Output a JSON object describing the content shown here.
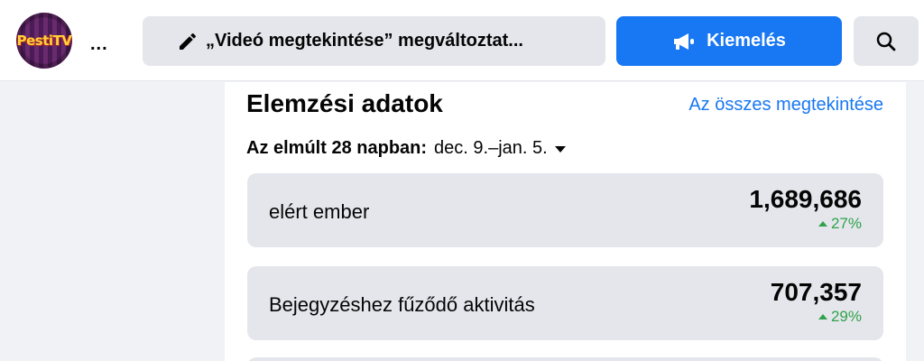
{
  "header": {
    "avatar_logo": "PestiTV",
    "more_label": "...",
    "edit_button_label": "„Videó megtekintése” megváltoztat...",
    "promote_button_label": "Kiemelés",
    "icons": [
      "pencil-icon",
      "megaphone-icon",
      "search-icon"
    ]
  },
  "insights": {
    "title": "Elemzési adatok",
    "see_all": "Az összes megtekintése",
    "period_label": "Az elmúlt 28 napban:",
    "period_value": "dec. 9.–jan. 5.",
    "stats": [
      {
        "name": "elért ember",
        "value": "1,689,686",
        "change": "27%"
      },
      {
        "name": "Bejegyzéshez fűződő aktivitás",
        "value": "707,357",
        "change": "29%"
      }
    ]
  },
  "colors": {
    "accent": "#1877f2",
    "positive": "#31a24c",
    "card_bg": "#e4e6eb",
    "page_bg": "#f0f2f5"
  }
}
